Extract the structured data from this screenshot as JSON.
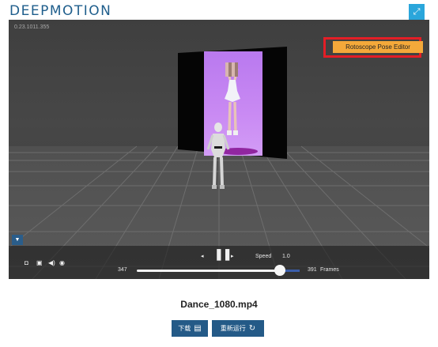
{
  "header": {
    "logo_text": "DEEPMOTION",
    "expand_icon": "expand-arrows-icon"
  },
  "viewer": {
    "version": "0.23.1011.355",
    "roto_button": "Rotoscope Pose Editor",
    "panel_toggle_icon": "chevron-down-icon"
  },
  "controls": {
    "left_icons": [
      "camera-icon",
      "lock-icon",
      "volume-icon",
      "eye-icon"
    ],
    "prev_icon": "step-back-icon",
    "pause_icon": "pause-icon",
    "next_icon": "step-forward-icon",
    "speed_label": "Speed",
    "speed_value": "1.0",
    "start_frame": "347",
    "total_frames": "391",
    "frames_label": "Frames",
    "playhead_position": 0.88
  },
  "file": {
    "name": "Dance_1080.mp4"
  },
  "actions": {
    "download_label": "下载",
    "rerun_label": "重新运行"
  },
  "colors": {
    "accent": "#2aa6db",
    "button": "#245a87",
    "roto": "#f4a93a",
    "highlight": "#e41e26",
    "video_bg": "#c98af3"
  }
}
